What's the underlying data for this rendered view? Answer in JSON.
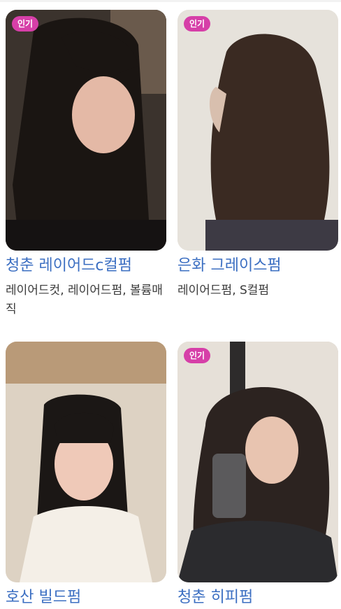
{
  "badge_label": "인기",
  "items": [
    {
      "title": "청춘 레이어드c컬펌",
      "tags": "레이어드컷, 레이어드펌, 볼륨매직",
      "badge": true
    },
    {
      "title": "은화 그레이스펌",
      "tags": "레이어드펌, S컬펌",
      "badge": true
    },
    {
      "title": "호산 빌드펌",
      "tags": "",
      "badge": false
    },
    {
      "title": "청춘 히피펌",
      "tags": "",
      "badge": true
    }
  ],
  "colors": {
    "title": "#3c6fc2",
    "badge_bg": "#d63fa8",
    "tags": "#3b3b3b"
  }
}
